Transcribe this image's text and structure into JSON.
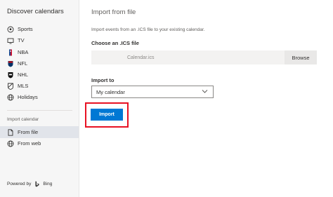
{
  "sidebar": {
    "title": "Discover calendars",
    "items": [
      {
        "label": "Sports",
        "icon": "soccer-ball-icon"
      },
      {
        "label": "TV",
        "icon": "tv-icon"
      },
      {
        "label": "NBA",
        "icon": "nba-logo-icon"
      },
      {
        "label": "NFL",
        "icon": "nfl-shield-icon"
      },
      {
        "label": "NHL",
        "icon": "nhl-shield-icon"
      },
      {
        "label": "MLS",
        "icon": "mls-logo-icon"
      },
      {
        "label": "Holidays",
        "icon": "globe-icon"
      }
    ],
    "import_section_label": "Import calendar",
    "import_items": [
      {
        "label": "From file",
        "icon": "file-icon",
        "active": true
      },
      {
        "label": "From web",
        "icon": "web-globe-icon",
        "active": false
      }
    ],
    "powered_by": {
      "prefix": "Powered by",
      "brand": "Bing"
    }
  },
  "main": {
    "title": "Import from file",
    "description": "Import events from an .ICS file to your existing calendar.",
    "choose_label": "Choose an .ICS file",
    "file_name": "Calendar.ics",
    "browse_label": "Browse",
    "import_to_label": "Import to",
    "selected_calendar": "My calendar",
    "import_button_label": "Import"
  },
  "colors": {
    "accent": "#0078d4",
    "highlight": "#e81123",
    "sidebar_bg": "#f6f6f6",
    "active_item_bg": "#e1e4ea"
  }
}
